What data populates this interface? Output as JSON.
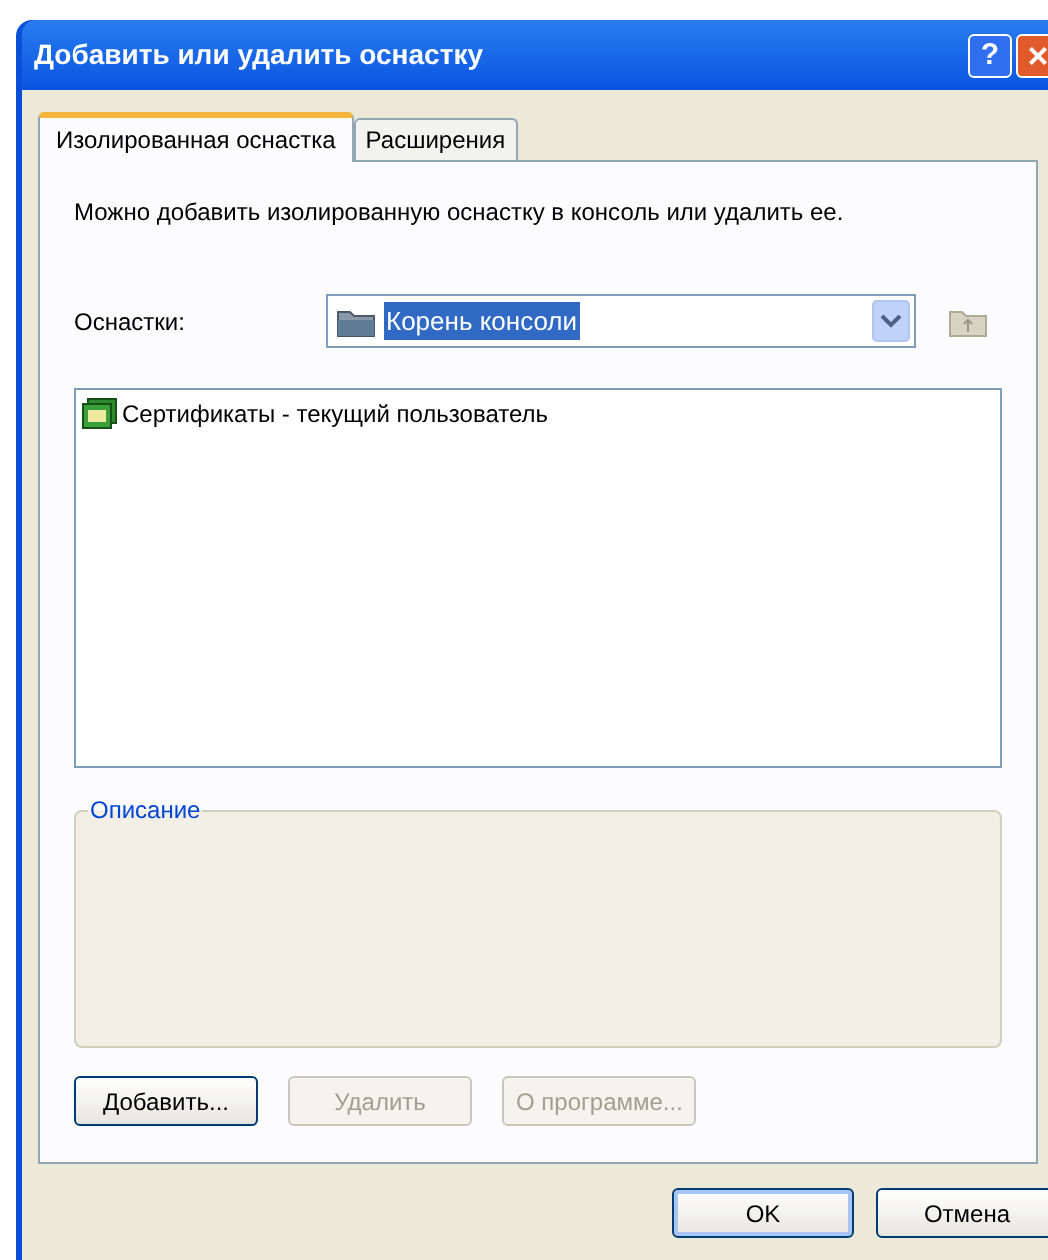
{
  "window": {
    "title": "Добавить или удалить оснастку",
    "help": "?",
    "close": "×"
  },
  "tabs": [
    {
      "label": "Изолированная оснастка",
      "selected": true
    },
    {
      "label": "Расширения",
      "selected": false
    }
  ],
  "intro": "Можно добавить изолированную оснастку в консоль или удалить ее.",
  "snapins_label": "Оснастки:",
  "snapins_combo": {
    "value": "Корень консоли"
  },
  "snapin_list": [
    {
      "label": "Сертификаты - текущий пользователь",
      "selected": false
    }
  ],
  "description": {
    "legend": "Описание"
  },
  "actions": [
    {
      "label": "Добавить...",
      "disabled": false
    },
    {
      "label": "Удалить",
      "disabled": true
    },
    {
      "label": "О программе...",
      "disabled": true
    }
  ],
  "buttons": [
    "OK",
    "Отмена"
  ]
}
